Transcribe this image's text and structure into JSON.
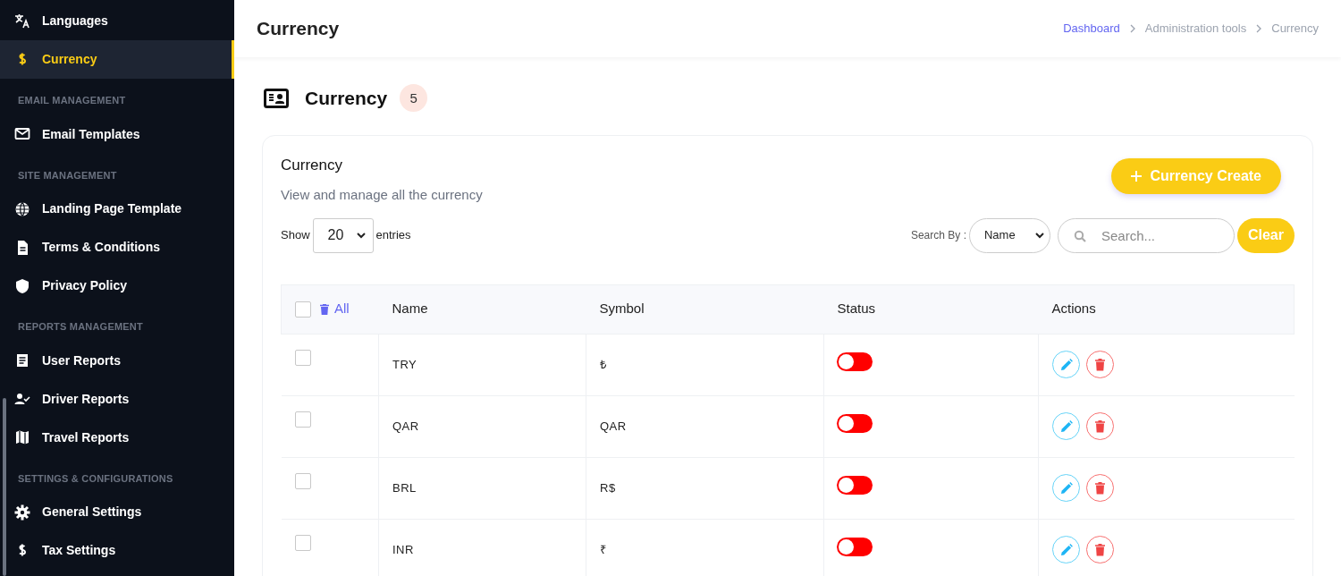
{
  "sidebar": {
    "items": [
      {
        "kind": "link",
        "label": "Languages",
        "selected": false
      },
      {
        "kind": "link",
        "label": "Currency",
        "selected": true
      },
      {
        "kind": "section",
        "label": "EMAIL MANAGEMENT"
      },
      {
        "kind": "link",
        "label": "Email Templates",
        "selected": false
      },
      {
        "kind": "section",
        "label": "SITE MANAGEMENT"
      },
      {
        "kind": "link",
        "label": "Landing Page Template",
        "selected": false
      },
      {
        "kind": "link",
        "label": "Terms & Conditions",
        "selected": false
      },
      {
        "kind": "link",
        "label": "Privacy Policy",
        "selected": false
      },
      {
        "kind": "section",
        "label": "REPORTS MANAGEMENT"
      },
      {
        "kind": "link",
        "label": "User Reports",
        "selected": false
      },
      {
        "kind": "link",
        "label": "Driver Reports",
        "selected": false
      },
      {
        "kind": "link",
        "label": "Travel Reports",
        "selected": false
      },
      {
        "kind": "section",
        "label": "SETTINGS & CONFIGURATIONS"
      },
      {
        "kind": "link",
        "label": "General Settings",
        "selected": false
      },
      {
        "kind": "link",
        "label": "Tax Settings",
        "selected": false
      }
    ]
  },
  "header": {
    "title": "Currency",
    "breadcrumbs": [
      "Dashboard",
      "Administration tools",
      "Currency"
    ]
  },
  "page": {
    "title": "Currency",
    "count": "5"
  },
  "card": {
    "title": "Currency",
    "subtitle": "View and manage all the currency",
    "create_button": "Currency Create",
    "show_label": "Show",
    "page_size": "20",
    "entries_label": "entries",
    "search_by_label": "Search By :",
    "search_by": "Name",
    "search": {
      "placeholder": "Search..."
    },
    "clear_button": "Clear"
  },
  "table": {
    "select_all_label": "All",
    "select_all_checked": false,
    "columns": [
      "Name",
      "Symbol",
      "Status",
      "Actions"
    ],
    "rows": [
      {
        "checked": false,
        "name": "TRY",
        "symbol": "₺",
        "on": false
      },
      {
        "checked": false,
        "name": "QAR",
        "symbol": "QAR",
        "on": false
      },
      {
        "checked": false,
        "name": "BRL",
        "symbol": "R$",
        "on": false
      },
      {
        "checked": false,
        "name": "INR",
        "symbol": "₹",
        "on": false
      }
    ]
  }
}
